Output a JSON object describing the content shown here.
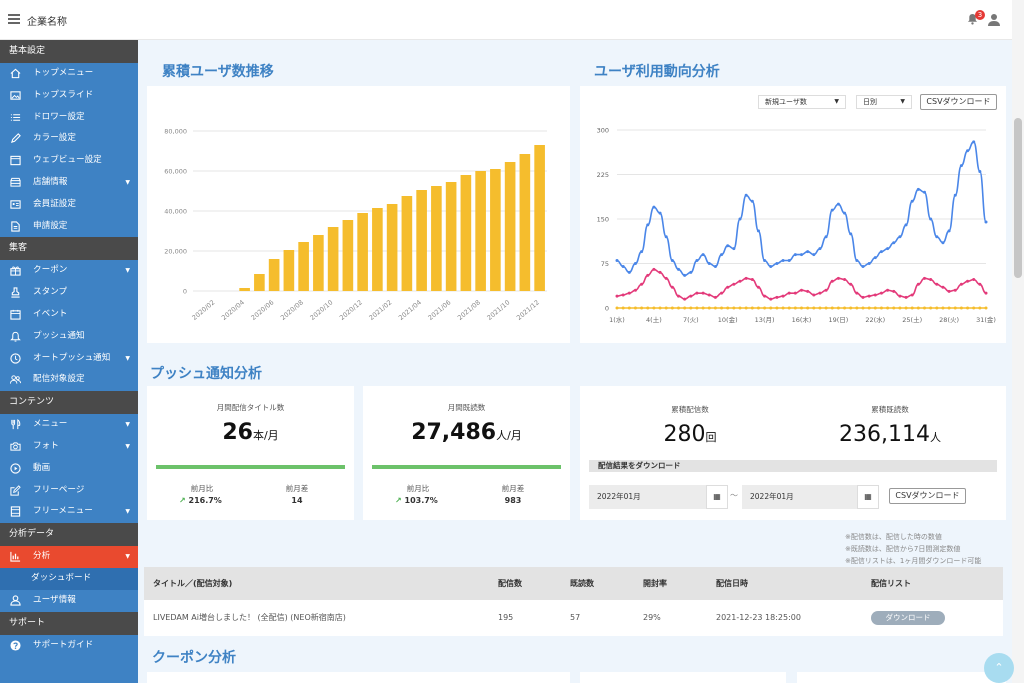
{
  "header": {
    "company": "企業名称",
    "notification_count": "3"
  },
  "sidebar": {
    "sections": [
      {
        "title": "基本設定",
        "items": [
          {
            "label": "トップメニュー",
            "icon": "home-icon"
          },
          {
            "label": "トップスライド",
            "icon": "image-icon"
          },
          {
            "label": "ドロワー設定",
            "icon": "list-icon"
          },
          {
            "label": "カラー設定",
            "icon": "pencil-icon"
          },
          {
            "label": "ウェブビュー設定",
            "icon": "window-icon"
          },
          {
            "label": "店舗情報",
            "icon": "store-icon",
            "caret": true
          },
          {
            "label": "会員証設定",
            "icon": "card-icon"
          },
          {
            "label": "申請設定",
            "icon": "document-icon"
          }
        ]
      },
      {
        "title": "集客",
        "items": [
          {
            "label": "クーポン",
            "icon": "gift-icon",
            "caret": true
          },
          {
            "label": "スタンプ",
            "icon": "stamp-icon"
          },
          {
            "label": "イベント",
            "icon": "calendar-icon"
          },
          {
            "label": "プッシュ通知",
            "icon": "bell-icon"
          },
          {
            "label": "オートプッシュ通知",
            "icon": "clock-icon",
            "caret": true
          },
          {
            "label": "配信対象設定",
            "icon": "users-icon"
          }
        ]
      },
      {
        "title": "コンテンツ",
        "items": [
          {
            "label": "メニュー",
            "icon": "utensils-icon",
            "caret": true
          },
          {
            "label": "フォト",
            "icon": "camera-icon",
            "caret": true
          },
          {
            "label": "動画",
            "icon": "play-icon"
          },
          {
            "label": "フリーページ",
            "icon": "edit-icon"
          },
          {
            "label": "フリーメニュー",
            "icon": "layout-icon",
            "caret": true
          }
        ]
      },
      {
        "title": "分析データ",
        "items": [
          {
            "label": "分析",
            "icon": "chart-icon",
            "caret": true,
            "active": true
          },
          {
            "label": "ダッシュボード",
            "sub": true
          },
          {
            "label": "ユーザ情報",
            "icon": "user-icon"
          }
        ]
      },
      {
        "title": "サポート",
        "items": [
          {
            "label": "サポートガイド",
            "icon": "help-icon"
          }
        ]
      }
    ]
  },
  "cumulative": {
    "title": "累積ユーザ数推移",
    "chart_data": {
      "type": "bar",
      "categories": [
        "2020/01",
        "2020/02",
        "2020/03",
        "2020/04",
        "2020/05",
        "2020/06",
        "2020/07",
        "2020/08",
        "2020/09",
        "2020/10",
        "2020/11",
        "2020/12",
        "2021/01",
        "2021/02",
        "2021/03",
        "2021/04",
        "2021/05",
        "2021/06",
        "2021/07",
        "2021/08",
        "2021/09",
        "2021/10",
        "2021/11",
        "2021/12"
      ],
      "tick_labels": [
        "2020/02",
        "2020/04",
        "2020/06",
        "2020/08",
        "2020/10",
        "2020/12",
        "2021/02",
        "2021/04",
        "2021/06",
        "2021/08",
        "2021/10",
        "2021/12"
      ],
      "values": [
        0,
        0,
        1500,
        8500,
        16000,
        20500,
        24500,
        28000,
        32000,
        35500,
        39000,
        41500,
        43500,
        47500,
        50500,
        52500,
        54500,
        58000,
        60000,
        61000,
        64500,
        68500,
        73000
      ],
      "y_ticks": [
        "0",
        "20,000",
        "40,000",
        "60,000",
        "80,000"
      ],
      "ylim": [
        0,
        80000
      ],
      "color": "#f5bd2d",
      "grid": true
    }
  },
  "usage": {
    "title": "ユーザ利用動向分析",
    "select1": "新規ユーザ数",
    "select2": "日別",
    "csv": "CSVダウンロード",
    "chart_data": {
      "type": "line",
      "x_tick_labels": [
        "1(水)",
        "4(土)",
        "7(火)",
        "10(金)",
        "13(月)",
        "16(木)",
        "19(日)",
        "22(水)",
        "25(土)",
        "28(火)",
        "31(金)"
      ],
      "y_ticks": [
        "0",
        "75",
        "150",
        "225",
        "300"
      ],
      "ylim": [
        0,
        300
      ],
      "grid": true,
      "series": [
        {
          "color": "#4a86e8",
          "values": [
            80,
            70,
            60,
            75,
            95,
            140,
            170,
            160,
            120,
            80,
            65,
            55,
            60,
            80,
            90,
            75,
            70,
            90,
            105,
            100,
            150,
            190,
            180,
            130,
            80,
            70,
            75,
            80,
            80,
            90,
            90,
            95,
            90,
            100,
            120,
            165,
            175,
            160,
            125,
            80,
            70,
            75,
            85,
            95,
            100,
            110,
            120,
            140,
            180,
            200,
            195,
            150,
            120,
            110,
            130,
            190,
            240,
            265,
            280,
            230,
            145
          ]
        },
        {
          "color": "#e33a7a",
          "values": [
            20,
            22,
            25,
            30,
            40,
            55,
            65,
            60,
            50,
            35,
            20,
            15,
            20,
            25,
            25,
            22,
            18,
            25,
            35,
            40,
            45,
            50,
            48,
            35,
            20,
            15,
            18,
            20,
            25,
            25,
            30,
            28,
            22,
            25,
            30,
            45,
            50,
            48,
            40,
            25,
            18,
            20,
            22,
            25,
            30,
            28,
            20,
            18,
            22,
            40,
            50,
            48,
            40,
            35,
            28,
            30,
            40,
            45,
            48,
            40,
            25
          ]
        },
        {
          "color": "#f5bd2d",
          "values": [
            0,
            0,
            0,
            0,
            0,
            0,
            0,
            0,
            0,
            0,
            0,
            0,
            0,
            0,
            0,
            0,
            0,
            0,
            0,
            0,
            0,
            0,
            0,
            0,
            0,
            0,
            0,
            0,
            0,
            0,
            0,
            0,
            0,
            0,
            0,
            0,
            0,
            0,
            0,
            0,
            0,
            0,
            0,
            0,
            0,
            0,
            0,
            0,
            0,
            0,
            0,
            0,
            0,
            0,
            0,
            0,
            0,
            0,
            0,
            0,
            0
          ]
        }
      ]
    }
  },
  "push": {
    "title": "プッシュ通知分析",
    "card1": {
      "label": "月間配信タイトル数",
      "value": "26",
      "unit": "本/月",
      "prev_label": "前月比",
      "prev_value": "216.7%",
      "diff_label": "前月差",
      "diff_value": "14"
    },
    "card2": {
      "label": "月間既読数",
      "value": "27,486",
      "unit": "人/月",
      "prev_label": "前月比",
      "prev_value": "103.7%",
      "diff_label": "前月差",
      "diff_value": "983"
    },
    "card3": {
      "label1": "累積配信数",
      "value1": "280",
      "unit1": "回",
      "label2": "累積既読数",
      "value2": "236,114",
      "unit2": "人",
      "download_title": "配信結果をダウンロード",
      "date_from": "2022年01月",
      "date_to": "2022年01月",
      "separator": "〜",
      "csv": "CSVダウンロード"
    },
    "notes": [
      "※配信数は、配信した時の数値",
      "※既読数は、配信から7日間測定数値",
      "※配信リストは、1ヶ月間ダウンロード可能"
    ]
  },
  "table": {
    "headers": [
      "タイトル／(配信対象)",
      "配信数",
      "既読数",
      "開封率",
      "配信日時",
      "配信リスト"
    ],
    "row": {
      "title": "LIVEDAM Ai増台しました！ (全配信) (NEO新宿南店)",
      "sent": "195",
      "read": "57",
      "rate": "29%",
      "date": "2021-12-23 18:25:00",
      "download": "ダウンロード"
    }
  },
  "coupon": {
    "title": "クーポン分析"
  }
}
